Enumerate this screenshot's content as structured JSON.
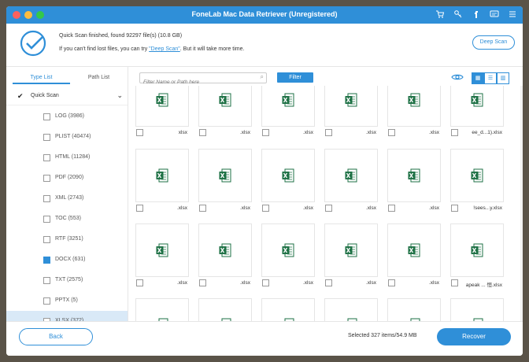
{
  "window": {
    "title": "FoneLab Mac Data Retriever (Unregistered)"
  },
  "status": {
    "line1": "Quick Scan finished, found 92297 file(s) (10.8 GB)",
    "line2_prefix": "If you can't find lost files, you can try ",
    "line2_link": "\"Deep Scan\"",
    "line2_suffix": ". But it will take more time.",
    "deep_scan_button": "Deep Scan"
  },
  "sidebar": {
    "tabs": [
      "Type List",
      "Path List"
    ],
    "scan_label": "Quick Scan",
    "categories": [
      {
        "label": "LOG (3986)",
        "checked": false,
        "selected": false
      },
      {
        "label": "PLIST (40474)",
        "checked": false,
        "selected": false
      },
      {
        "label": "HTML (11284)",
        "checked": false,
        "selected": false
      },
      {
        "label": "PDF (2090)",
        "checked": false,
        "selected": false
      },
      {
        "label": "XML (2743)",
        "checked": false,
        "selected": false
      },
      {
        "label": "TOC (553)",
        "checked": false,
        "selected": false
      },
      {
        "label": "RTF (3251)",
        "checked": false,
        "selected": false
      },
      {
        "label": "DOCX (631)",
        "checked": true,
        "selected": false
      },
      {
        "label": "TXT (2575)",
        "checked": false,
        "selected": false
      },
      {
        "label": "PPTX (5)",
        "checked": false,
        "selected": false
      },
      {
        "label": "XLSX (372)",
        "checked": false,
        "selected": true
      }
    ]
  },
  "toolbar": {
    "search_placeholder": "Filter Name or Path here",
    "filter_button": "Filter"
  },
  "files": [
    [
      "xlsx",
      ".xlsx",
      ".xlsx",
      ".xlsx",
      ".xlsx",
      "ee_d...1).xlsx"
    ],
    [
      ".xlsx",
      ".xlsx",
      ".xlsx",
      ".xlsx",
      ".xlsx",
      "!sees...y.xlsx"
    ],
    [
      ".xlsx",
      ".xlsx",
      ".xlsx",
      ".xlsx",
      ".xlsx",
      "apeak ... 恒.xlsx"
    ],
    [
      "",
      "",
      "",
      "",
      "",
      ""
    ]
  ],
  "footer": {
    "back": "Back",
    "selected": "Selected 327 items/54.9 MB",
    "recover": "Recover"
  },
  "colors": {
    "accent": "#2f8fd8",
    "excel": "#1e7145"
  }
}
